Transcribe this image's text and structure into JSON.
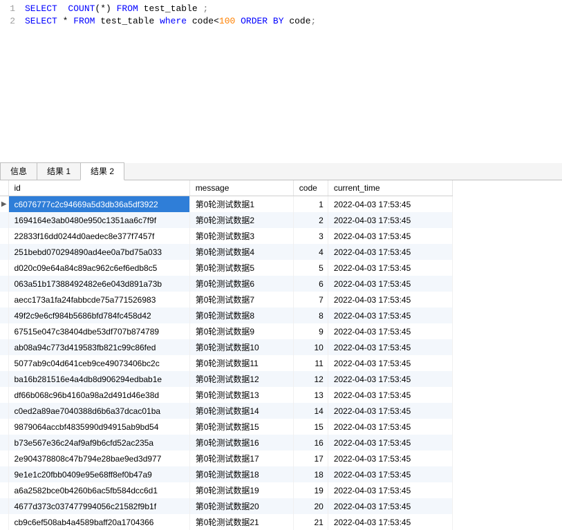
{
  "editor": {
    "lines": [
      {
        "num": "1",
        "tokens": [
          {
            "t": "SELECT  COUNT",
            "c": "kw"
          },
          {
            "t": "(*)",
            "c": "plain"
          },
          {
            "t": " FROM",
            "c": "kw"
          },
          {
            "t": " test_table ",
            "c": "plain"
          },
          {
            "t": ";",
            "c": "op"
          }
        ]
      },
      {
        "num": "2",
        "tokens": [
          {
            "t": "SELECT",
            "c": "kw"
          },
          {
            "t": " * ",
            "c": "plain"
          },
          {
            "t": "FROM",
            "c": "kw"
          },
          {
            "t": " test_table ",
            "c": "plain"
          },
          {
            "t": "where",
            "c": "kw"
          },
          {
            "t": " code<",
            "c": "plain"
          },
          {
            "t": "100",
            "c": "num"
          },
          {
            "t": " ORDER BY",
            "c": "kw"
          },
          {
            "t": " code",
            "c": "plain"
          },
          {
            "t": ";",
            "c": "op"
          }
        ]
      }
    ]
  },
  "tabs": {
    "items": [
      {
        "label": "信息",
        "active": false
      },
      {
        "label": "结果 1",
        "active": false
      },
      {
        "label": "结果 2",
        "active": true
      }
    ]
  },
  "grid": {
    "columns": [
      "id",
      "message",
      "code",
      "current_time"
    ],
    "selectedRow": 0,
    "selectedCol": 0,
    "rows": [
      {
        "id": "c6076777c2c94669a5d3db36a5df3922",
        "message": "第0轮测试数据1",
        "code": 1,
        "current_time": "2022-04-03 17:53:45"
      },
      {
        "id": "1694164e3ab0480e950c1351aa6c7f9f",
        "message": "第0轮测试数据2",
        "code": 2,
        "current_time": "2022-04-03 17:53:45"
      },
      {
        "id": "22833f16dd0244d0aedec8e377f7457f",
        "message": "第0轮测试数据3",
        "code": 3,
        "current_time": "2022-04-03 17:53:45"
      },
      {
        "id": "251bebd070294890ad4ee0a7bd75a033",
        "message": "第0轮测试数据4",
        "code": 4,
        "current_time": "2022-04-03 17:53:45"
      },
      {
        "id": "d020c09e64a84c89ac962c6ef6edb8c5",
        "message": "第0轮测试数据5",
        "code": 5,
        "current_time": "2022-04-03 17:53:45"
      },
      {
        "id": "063a51b17388492482e6e043d891a73b",
        "message": "第0轮测试数据6",
        "code": 6,
        "current_time": "2022-04-03 17:53:45"
      },
      {
        "id": "aecc173a1fa24fabbcde75a771526983",
        "message": "第0轮测试数据7",
        "code": 7,
        "current_time": "2022-04-03 17:53:45"
      },
      {
        "id": "49f2c9e6cf984b5686bfd784fc458d42",
        "message": "第0轮测试数据8",
        "code": 8,
        "current_time": "2022-04-03 17:53:45"
      },
      {
        "id": "67515e047c38404dbe53df707b874789",
        "message": "第0轮测试数据9",
        "code": 9,
        "current_time": "2022-04-03 17:53:45"
      },
      {
        "id": "ab08a94c773d419583fb821c99c86fed",
        "message": "第0轮测试数据10",
        "code": 10,
        "current_time": "2022-04-03 17:53:45"
      },
      {
        "id": "5077ab9c04d641ceb9ce49073406bc2c",
        "message": "第0轮测试数据11",
        "code": 11,
        "current_time": "2022-04-03 17:53:45"
      },
      {
        "id": "ba16b281516e4a4db8d906294edbab1e",
        "message": "第0轮测试数据12",
        "code": 12,
        "current_time": "2022-04-03 17:53:45"
      },
      {
        "id": "df66b068c96b4160a98a2d491d46e38d",
        "message": "第0轮测试数据13",
        "code": 13,
        "current_time": "2022-04-03 17:53:45"
      },
      {
        "id": "c0ed2a89ae7040388d6b6a37dcac01ba",
        "message": "第0轮测试数据14",
        "code": 14,
        "current_time": "2022-04-03 17:53:45"
      },
      {
        "id": "9879064accbf4835990d94915ab9bd54",
        "message": "第0轮测试数据15",
        "code": 15,
        "current_time": "2022-04-03 17:53:45"
      },
      {
        "id": "b73e567e36c24af9af9b6cfd52ac235a",
        "message": "第0轮测试数据16",
        "code": 16,
        "current_time": "2022-04-03 17:53:45"
      },
      {
        "id": "2e904378808c47b794e28bae9ed3d977",
        "message": "第0轮测试数据17",
        "code": 17,
        "current_time": "2022-04-03 17:53:45"
      },
      {
        "id": "9e1e1c20fbb0409e95e68ff8ef0b47a9",
        "message": "第0轮测试数据18",
        "code": 18,
        "current_time": "2022-04-03 17:53:45"
      },
      {
        "id": "a6a2582bce0b4260b6ac5fb584dcc6d1",
        "message": "第0轮测试数据19",
        "code": 19,
        "current_time": "2022-04-03 17:53:45"
      },
      {
        "id": "4677d373c037477994056c21582f9b1f",
        "message": "第0轮测试数据20",
        "code": 20,
        "current_time": "2022-04-03 17:53:45"
      },
      {
        "id": "cb9c6ef508ab4a4589baff20a1704366",
        "message": "第0轮测试数据21",
        "code": 21,
        "current_time": "2022-04-03 17:53:45"
      }
    ]
  }
}
